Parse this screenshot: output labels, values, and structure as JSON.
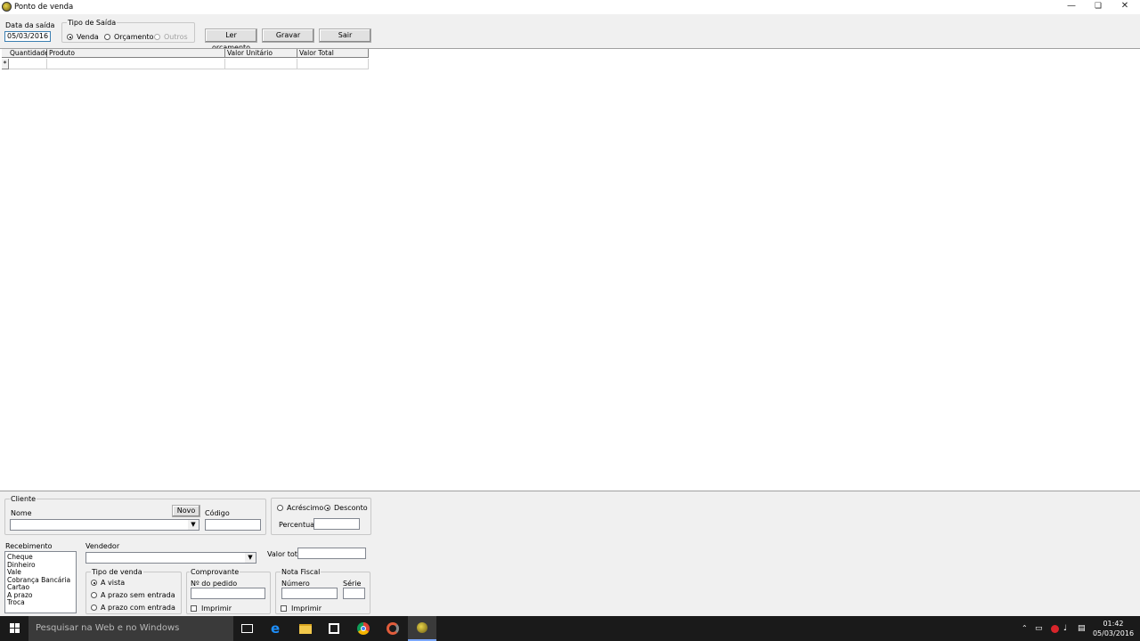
{
  "window": {
    "title": "Ponto de venda",
    "controls": [
      "minimize-icon",
      "restore-icon",
      "close-icon"
    ]
  },
  "toolbar": {
    "data_saida_label": "Data da saída",
    "data_saida_value": "05/03/2016",
    "tipo_saida_legend": "Tipo de Saída",
    "tipo_saida_options": [
      {
        "label": "Venda",
        "selected": true,
        "enabled": true
      },
      {
        "label": "Orçamento",
        "selected": false,
        "enabled": true
      },
      {
        "label": "Outros",
        "selected": false,
        "enabled": false
      }
    ],
    "ler_orcamento_label": "Ler orçamento",
    "gravar_label": "Gravar",
    "sair_label": "Sair"
  },
  "grid": {
    "columns": [
      "Quantidade",
      "Produto",
      "Valor Unitário",
      "Valor Total"
    ],
    "new_row_marker": "*",
    "rows": []
  },
  "cliente": {
    "legend": "Cliente",
    "nome_label": "Nome",
    "nome_value": "",
    "novo_label": "Novo",
    "codigo_label": "Código",
    "codigo_value": ""
  },
  "ajuste": {
    "acrescimo_label": "Acréscimo",
    "desconto_label": "Desconto",
    "selected": "Desconto",
    "percentual_label": "Percentual",
    "percentual_value": ""
  },
  "recebimento": {
    "label": "Recebimento",
    "items": [
      "Cheque",
      "Dinheiro",
      "Vale",
      "Cobrança Bancária",
      "Cartao",
      "A prazo",
      "Troca"
    ]
  },
  "vendedor": {
    "label": "Vendedor",
    "value": ""
  },
  "valor_total": {
    "label": "Valor total",
    "value": ""
  },
  "tipo_venda": {
    "legend": "Tipo de venda",
    "options": [
      {
        "label": "A vista",
        "selected": true
      },
      {
        "label": "A prazo sem entrada",
        "selected": false
      },
      {
        "label": "A prazo com entrada",
        "selected": false
      }
    ]
  },
  "comprovante": {
    "legend": "Comprovante",
    "pedido_label": "Nº do pedido",
    "pedido_value": "",
    "imprimir_label": "Imprimir"
  },
  "nota_fiscal": {
    "legend": "Nota Fiscal",
    "numero_label": "Número",
    "serie_label": "Série",
    "imprimir_label": "Imprimir"
  },
  "taskbar": {
    "search_placeholder": "Pesquisar na Web e no Windows",
    "icons": [
      "task-view-icon",
      "edge-icon",
      "file-explorer-icon",
      "store-icon",
      "chrome-icon",
      "app-icon",
      "ponto-de-venda-icon"
    ],
    "time": "01:42",
    "date": "05/03/2016"
  }
}
